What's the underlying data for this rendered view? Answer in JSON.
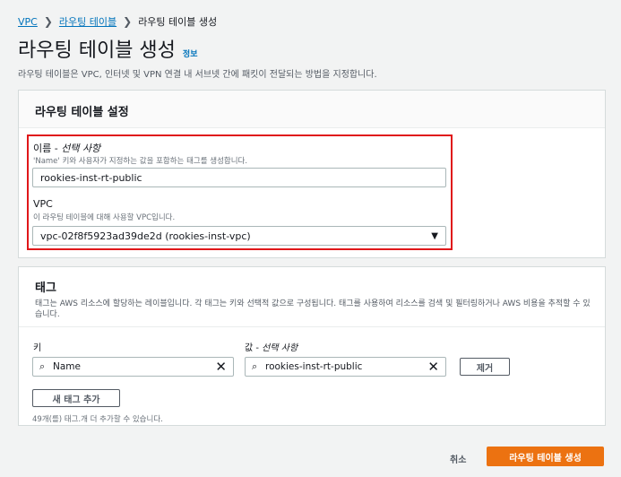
{
  "breadcrumb": {
    "vpc": "VPC",
    "route_tables": "라우팅 테이블",
    "current": "라우팅 테이블 생성"
  },
  "header": {
    "title": "라우팅 테이블 생성",
    "info": "정보",
    "description": "라우팅 테이블은 VPC, 인터넷 및 VPN 연결 내 서브넷 간에 패킷이 전달되는 방법을 지정합니다."
  },
  "settings": {
    "title": "라우팅 테이블 설정",
    "name_label": "이름 - ",
    "name_optional": "선택 사항",
    "name_hint": "'Name' 키와 사용자가 지정하는 값을 포함하는 태그를 생성합니다.",
    "name_value": "rookies-inst-rt-public",
    "vpc_label": "VPC",
    "vpc_hint": "이 라우팅 테이블에 대해 사용할 VPC입니다.",
    "vpc_value": "vpc-02f8f5923ad39de2d (rookies-inst-vpc)",
    "vpc_arrow": "▼"
  },
  "tags": {
    "title": "태그",
    "description": "태그는 AWS 리소스에 할당하는 레이블입니다. 각 태그는 키와 선택적 값으로 구성됩니다. 태그를 사용하여 리소스를 검색 및 필터링하거나 AWS 비용을 추적할 수 있습니다.",
    "key_label": "키",
    "value_label": "값 - ",
    "value_optional": "선택 사항",
    "key_value": "Name",
    "value_value": "rookies-inst-rt-public",
    "remove_button": "제거",
    "add_button": "새 태그 추가",
    "limit_note": "49개(를) 태그.개 더 추가할 수 있습니다."
  },
  "footer": {
    "cancel": "취소",
    "create": "라우팅 테이블 생성"
  },
  "colors": {
    "accent": "#0073bb",
    "primary": "#ec7211",
    "highlight": "#e0171a"
  }
}
